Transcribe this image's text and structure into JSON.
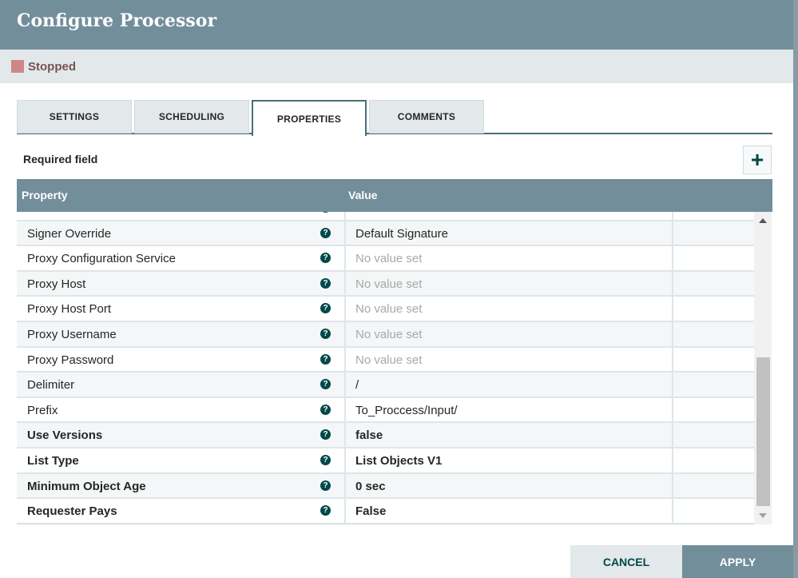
{
  "header": {
    "title": "Configure Processor"
  },
  "status": {
    "label": "Stopped"
  },
  "tabs": [
    "SETTINGS",
    "SCHEDULING",
    "PROPERTIES",
    "COMMENTS"
  ],
  "required_label": "Required field",
  "add_label": "+",
  "table": {
    "headers": {
      "property": "Property",
      "value": "Value"
    },
    "rows": [
      {
        "property": "",
        "value": "",
        "bold": false,
        "empty": false
      },
      {
        "property": "Signer Override",
        "value": "Default Signature",
        "bold": false,
        "empty": false
      },
      {
        "property": "Proxy Configuration Service",
        "value": "No value set",
        "bold": false,
        "empty": true
      },
      {
        "property": "Proxy Host",
        "value": "No value set",
        "bold": false,
        "empty": true
      },
      {
        "property": "Proxy Host Port",
        "value": "No value set",
        "bold": false,
        "empty": true
      },
      {
        "property": "Proxy Username",
        "value": "No value set",
        "bold": false,
        "empty": true
      },
      {
        "property": "Proxy Password",
        "value": "No value set",
        "bold": false,
        "empty": true
      },
      {
        "property": "Delimiter",
        "value": "/",
        "bold": false,
        "empty": false
      },
      {
        "property": "Prefix",
        "value": "To_Proccess/Input/",
        "bold": false,
        "empty": false
      },
      {
        "property": "Use Versions",
        "value": "false",
        "bold": true,
        "empty": false
      },
      {
        "property": "List Type",
        "value": "List Objects V1",
        "bold": true,
        "empty": false
      },
      {
        "property": "Minimum Object Age",
        "value": "0 sec",
        "bold": true,
        "empty": false
      },
      {
        "property": "Requester Pays",
        "value": "False",
        "bold": true,
        "empty": false
      }
    ]
  },
  "help_glyph": "?",
  "buttons": {
    "cancel": "CANCEL",
    "apply": "APPLY"
  }
}
